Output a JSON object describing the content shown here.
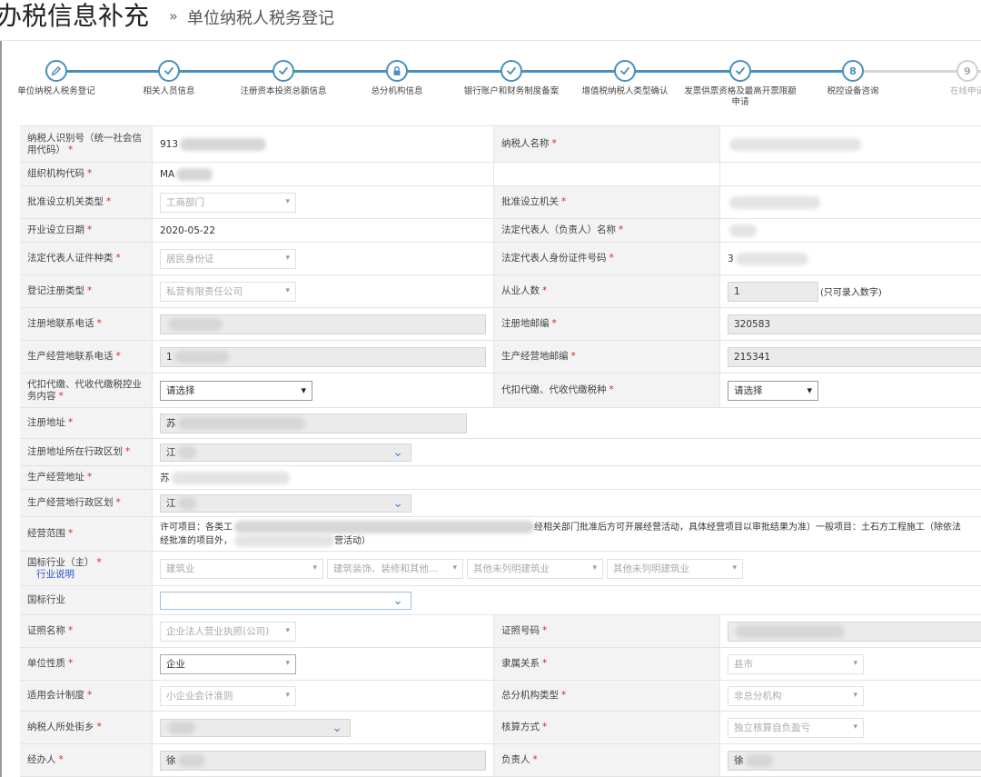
{
  "header": {
    "title": "办税信息补充",
    "separator": "»",
    "subtitle": "单位纳税人税务登记"
  },
  "steps": [
    {
      "label": "单位纳税人税务登记",
      "state": "done",
      "icon": "edit-icon",
      "number": ""
    },
    {
      "label": "相关人员信息",
      "state": "done",
      "icon": "check-icon",
      "number": ""
    },
    {
      "label": "注册资本投资总额信息",
      "state": "done",
      "icon": "check-icon",
      "number": ""
    },
    {
      "label": "总分机构信息",
      "state": "done",
      "icon": "lock-icon",
      "number": ""
    },
    {
      "label": "银行账户和财务制度备案",
      "state": "done",
      "icon": "check-icon",
      "number": ""
    },
    {
      "label": "增值税纳税人类型确认",
      "state": "done",
      "icon": "check-icon",
      "number": ""
    },
    {
      "label": "发票供票资格及最高开票限额申请",
      "state": "done",
      "icon": "check-icon",
      "number": ""
    },
    {
      "label": "税控设备咨询",
      "state": "current",
      "icon": "number",
      "number": "8"
    },
    {
      "label": "在线申请",
      "state": "todo",
      "icon": "number",
      "number": "9"
    }
  ],
  "form": {
    "r1": {
      "l1": "纳税人识别号（统一社会信用代码）",
      "v1": "913",
      "l2": "纳税人名称"
    },
    "r2": {
      "l1": "组织机构代码",
      "v1": "MA"
    },
    "r3": {
      "l1": "批准设立机关类型",
      "v1": "工商部门",
      "l2": "批准设立机关"
    },
    "r4": {
      "l1": "开业设立日期",
      "v1": "2020-05-22",
      "l2": "法定代表人（负责人）名称"
    },
    "r5": {
      "l1": "法定代表人证件种类",
      "v1": "居民身份证",
      "l2": "法定代表人身份证件号码",
      "v2": "3"
    },
    "r6": {
      "l1": "登记注册类型",
      "v1": "私营有限责任公司",
      "l2": "从业人数",
      "v2": "1",
      "hint": "(只可录入数字)"
    },
    "r7": {
      "l1": "注册地联系电话",
      "l2": "注册地邮编",
      "v2": "320583"
    },
    "r8": {
      "l1": "生产经营地联系电话",
      "v1": "1",
      "l2": "生产经营地邮编",
      "v2": "215341"
    },
    "r9": {
      "l1": "代扣代缴、代收代缴税控业务内容",
      "v1": "请选择",
      "l2": "代扣代缴、代收代缴税种",
      "v2": "请选择"
    },
    "r10": {
      "l1": "注册地址",
      "v1": "苏"
    },
    "r11": {
      "l1": "注册地址所在行政区划",
      "v1": "江"
    },
    "r12": {
      "l1": "生产经营地址",
      "v1": "苏"
    },
    "r13": {
      "l1": "生产经营地行政区划",
      "v1": "江"
    },
    "r14": {
      "l1": "经营范围",
      "line1a": "许可项目：各类工",
      "line1b": "经相关部门批准后方可开展经营活动，具体经营项目以审批结果为准）一般项目：土石方工程施工（除依法",
      "line2a": "经批准的项目外，",
      "line2b": "营活动）"
    },
    "r15": {
      "l1": "国标行业（主）",
      "link": "行业说明",
      "s1": "建筑业",
      "s2": "建筑装饰、装修和其他...",
      "s3": "其他未列明建筑业",
      "s4": "其他未列明建筑业"
    },
    "r16": {
      "l1": "国标行业"
    },
    "r17": {
      "l1": "证照名称",
      "v1": "企业法人营业执照(公司)",
      "l2": "证照号码"
    },
    "r18": {
      "l1": "单位性质",
      "v1": "企业",
      "l2": "隶属关系",
      "v2": "县市"
    },
    "r19": {
      "l1": "适用会计制度",
      "v1": "小企业会计准则",
      "l2": "总分机构类型",
      "v2": "非总分机构"
    },
    "r20": {
      "l1": "纳税人所处街乡",
      "l2": "核算方式",
      "v2": "独立核算自负盈亏"
    },
    "r21": {
      "l1": "经办人",
      "v1": "徐",
      "l2": "负责人",
      "v2": "徐"
    }
  },
  "colors": {
    "accent": "#4a8fb9",
    "required": "#d9281c",
    "link": "#2a55c8"
  }
}
